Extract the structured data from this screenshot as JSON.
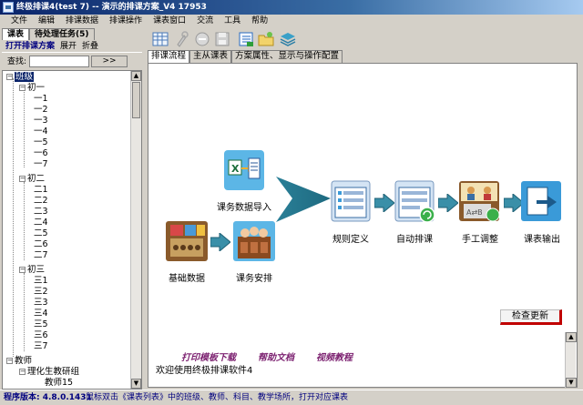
{
  "window": {
    "title": "终极排课4(test  7) -- 演示的排课方案_V4   17953"
  },
  "menu": [
    "文件",
    "编辑",
    "排课数据",
    "排课操作",
    "课表窗口",
    "交流",
    "工具",
    "帮助"
  ],
  "left_panel": {
    "tabs": [
      "课表",
      "待处理任务(5)"
    ],
    "actions": [
      "打开排课方案",
      "展开",
      "折叠"
    ],
    "search_label": "查找:",
    "search_button": ">>",
    "tree": {
      "root": "班级",
      "groups": [
        {
          "label": "初一",
          "items": [
            "一1",
            "一2",
            "一3",
            "一4",
            "一5",
            "一6",
            "一7"
          ]
        },
        {
          "label": "初二",
          "items": [
            "二1",
            "二2",
            "二3",
            "二4",
            "二5",
            "二6",
            "二7"
          ]
        },
        {
          "label": "初三",
          "items": [
            "三1",
            "三2",
            "三3",
            "三4",
            "三5",
            "三6",
            "三7"
          ]
        }
      ],
      "root2": "教师",
      "root2_group": "理化生教研组",
      "root2_item": "教师15"
    }
  },
  "toolbar": {
    "icons": [
      "grid-icon",
      "tools-icon",
      "cancel-icon",
      "disk-icon",
      "list-icon",
      "folder-icon",
      "layers-icon"
    ]
  },
  "content_tabs": [
    "排课流程",
    "主从课表",
    "方案属性、显示与操作配置"
  ],
  "flow": {
    "import": "课务数据导入",
    "basic": "基础数据",
    "arrange": "课务安排",
    "rules": "规则定义",
    "auto": "自动排课",
    "manual": "手工调整",
    "output": "课表输出"
  },
  "buttons": {
    "check_update": "检查更新"
  },
  "links": {
    "print_template": "打印模板下载",
    "help_doc": "帮助文档",
    "video": "视频教程"
  },
  "welcome": "欢迎使用终极排课软件4",
  "status": {
    "version": "程序版本: 4.8.0.1431",
    "tip": "鼠标双击《课表列表》中的班级、教师、科目、教学场所，打开对应课表"
  }
}
